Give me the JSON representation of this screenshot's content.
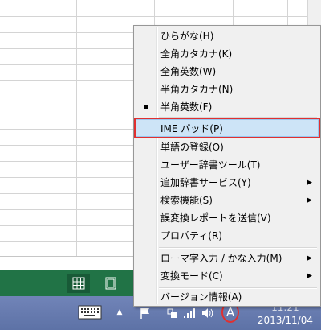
{
  "menu": {
    "items": [
      {
        "label": "ひらがな(H)"
      },
      {
        "label": "全角カタカナ(K)"
      },
      {
        "label": "全角英数(W)"
      },
      {
        "label": "半角カタカナ(N)"
      },
      {
        "label": "半角英数(F)",
        "checked": true
      },
      {
        "label": "IME パッド(P)",
        "highlighted": true
      },
      {
        "label": "単語の登録(O)"
      },
      {
        "label": "ユーザー辞書ツール(T)"
      },
      {
        "label": "追加辞書サービス(Y)",
        "submenu": true
      },
      {
        "label": "検索機能(S)",
        "submenu": true
      },
      {
        "label": "誤変換レポートを送信(V)"
      },
      {
        "label": "プロパティ(R)"
      },
      {
        "label": "ローマ字入力 / かな入力(M)",
        "submenu": true
      },
      {
        "label": "変換モード(C)",
        "submenu": true
      },
      {
        "label": "バージョン情報(A)"
      }
    ]
  },
  "taskbar": {
    "ime_indicator": "A",
    "clock_time": "11:21",
    "clock_date": "2013/11/04"
  },
  "colors": {
    "excel_green": "#217346",
    "highlight": "#cde4f7",
    "annotation_red": "#e03030"
  },
  "icons": [
    "keyboard-icon",
    "show-hidden-icons-icon",
    "flag-icon",
    "network-icon",
    "signal-icon",
    "volume-icon",
    "normal-view-icon",
    "page-layout-icon"
  ]
}
